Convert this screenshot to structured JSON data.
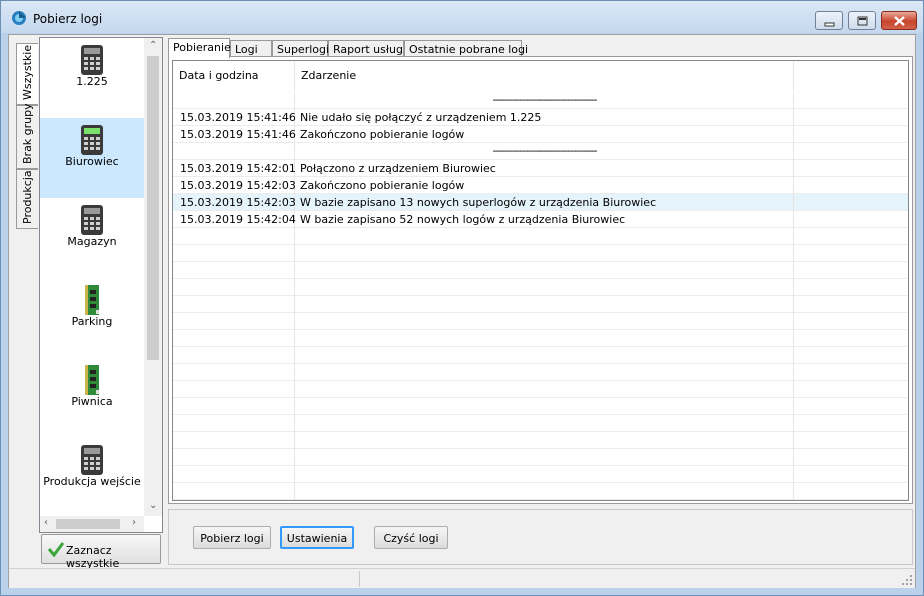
{
  "window": {
    "title": "Pobierz logi",
    "controls": {
      "minimize": "minimize-icon",
      "maximize": "maximize-icon",
      "close": "close-icon"
    }
  },
  "group_tabs": [
    {
      "label": "Wszystkie",
      "active": true
    },
    {
      "label": "Brak grupy",
      "active": false
    },
    {
      "label": "Produkcja",
      "active": false
    }
  ],
  "devices": [
    {
      "label": "1.225",
      "icon": "keypad-terminal-icon",
      "selected": false
    },
    {
      "label": "Biurowiec",
      "icon": "keypad-terminal-green-icon",
      "selected": true
    },
    {
      "label": "Magazyn",
      "icon": "keypad-terminal-icon",
      "selected": false
    },
    {
      "label": "Parking",
      "icon": "controller-board-icon",
      "selected": false
    },
    {
      "label": "Piwnica",
      "icon": "controller-board-icon",
      "selected": false
    },
    {
      "label": "Produkcja wejście",
      "icon": "keypad-terminal-icon",
      "selected": false
    }
  ],
  "select_all": {
    "label": "Zaznacz wszystkie",
    "icon": "checkmark-icon"
  },
  "tabs": [
    {
      "label": "Pobieranie",
      "active": true
    },
    {
      "label": "Logi",
      "active": false
    },
    {
      "label": "Superlogi",
      "active": false
    },
    {
      "label": "Raport usługi",
      "active": false
    },
    {
      "label": "Ostatnie pobrane logi",
      "active": false
    }
  ],
  "log_table": {
    "columns": [
      "Data i godzina",
      "Zdarzenie"
    ],
    "rows": [
      {
        "time": "",
        "event": "-----------------------------------",
        "separator": true
      },
      {
        "time": "15.03.2019 15:41:46",
        "event": "Nie udało się połączyć z urządzeniem 1.225"
      },
      {
        "time": "15.03.2019 15:41:46",
        "event": "Zakończono pobieranie logów"
      },
      {
        "time": "",
        "event": "-----------------------------------",
        "separator": true
      },
      {
        "time": "15.03.2019 15:42:01",
        "event": "Połączono z urządzeniem Biurowiec"
      },
      {
        "time": "15.03.2019 15:42:03",
        "event": "Zakończono pobieranie logów"
      },
      {
        "time": "15.03.2019 15:42:03",
        "event": "W bazie zapisano 13 nowych superlogów z urządzenia Biurowiec",
        "highlighted": true
      },
      {
        "time": "15.03.2019 15:42:04",
        "event": "W bazie zapisano 52 nowych logów z urządzenia Biurowiec"
      }
    ]
  },
  "buttons": {
    "download": "Pobierz logi",
    "settings": "Ustawienia",
    "clear": "Czyść logi"
  }
}
